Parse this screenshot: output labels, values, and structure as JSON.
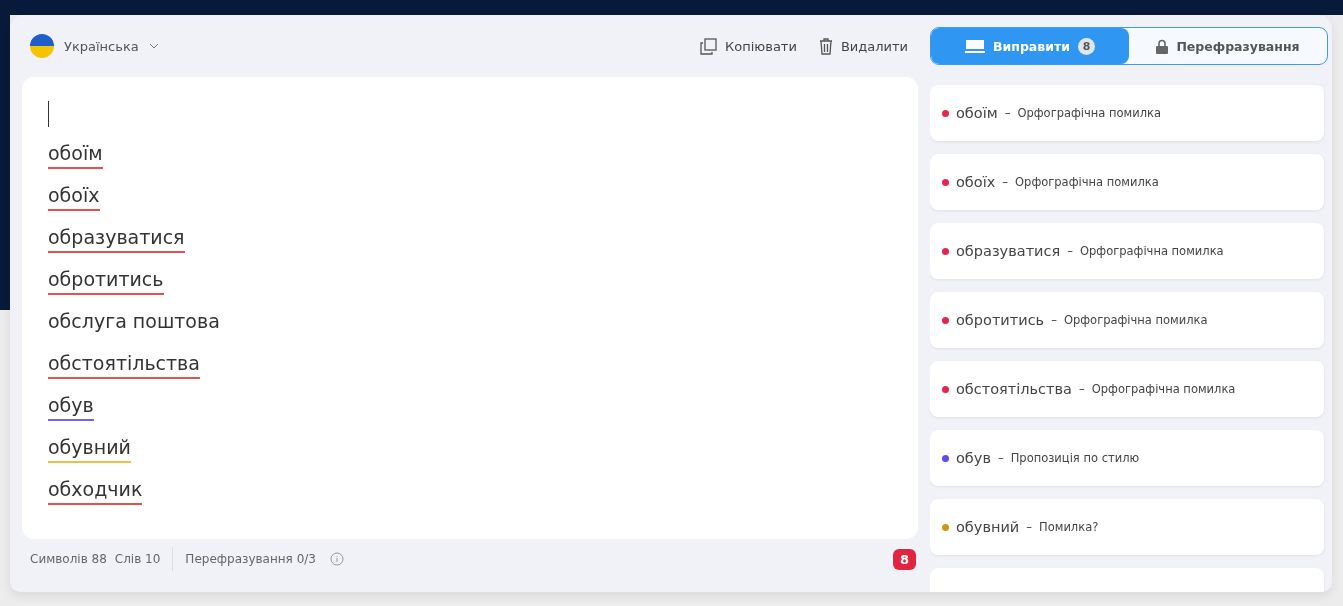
{
  "language": {
    "label": "Українська"
  },
  "actions": [
    {
      "kind": "copy",
      "label": "Копіювати"
    },
    {
      "kind": "delete",
      "label": "Видалити"
    }
  ],
  "tabs": [
    {
      "label": "Виправити",
      "badge": "8",
      "selected": true,
      "kind": "fix"
    },
    {
      "label": "Перефразування",
      "selected": false,
      "kind": "lock"
    }
  ],
  "editor": {
    "words": [
      {
        "text": "обоїм",
        "kind": "error"
      },
      {
        "text": "обоїх",
        "kind": "error"
      },
      {
        "text": "образуватися",
        "kind": "error"
      },
      {
        "text": "обротитись",
        "kind": "error"
      },
      {
        "text": "обслуга поштова",
        "kind": "plain"
      },
      {
        "text": "обстоятільства",
        "kind": "error"
      },
      {
        "text": "обув",
        "kind": "style"
      },
      {
        "text": "обувний",
        "kind": "warning"
      },
      {
        "text": "обходчик",
        "kind": "error"
      }
    ]
  },
  "status_bar": {
    "chars": "Символів 88",
    "words": "Слів 10",
    "paraphrase": "Перефразування 0/3",
    "count": "8"
  },
  "suggestions": [
    {
      "word": "обоїм",
      "dash": "–",
      "note": "Орфографічна помилка",
      "color": "#e0284f"
    },
    {
      "word": "обоїх",
      "dash": "–",
      "note": "Орфографічна помилка",
      "color": "#e0284f"
    },
    {
      "word": "образуватися",
      "dash": "–",
      "note": "Орфографічна помилка",
      "color": "#e0284f"
    },
    {
      "word": "обротитись",
      "dash": "–",
      "note": "Орфографічна помилка",
      "color": "#e0284f"
    },
    {
      "word": "обстоятільства",
      "dash": "–",
      "note": "Орфографічна помилка",
      "color": "#e0284f"
    },
    {
      "word": "обув",
      "dash": "–",
      "note": "Пропозиція по стилю",
      "color": "#5b4ef0"
    },
    {
      "word": "обувний",
      "dash": "–",
      "note": "Помилка?",
      "color": "#c99a12"
    }
  ]
}
